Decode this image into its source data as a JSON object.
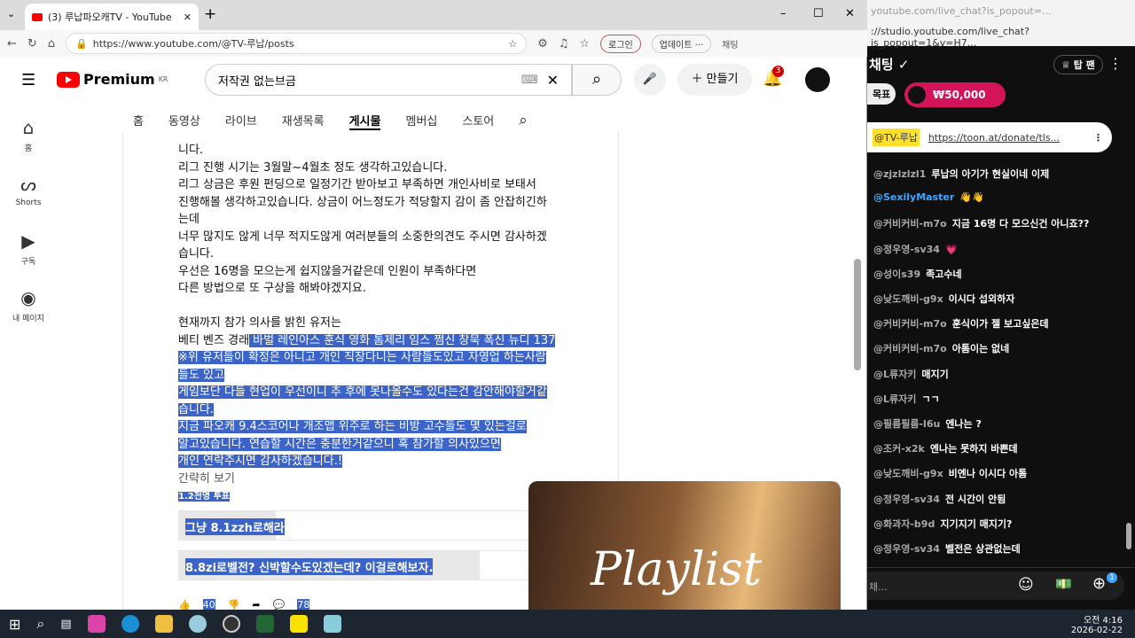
{
  "browser": {
    "tab_title": "(3) 루납파오캐TV - YouTube",
    "url": "https://www.youtube.com/@TV-루납/posts",
    "login": "로그인",
    "update": "업데이트 ···",
    "chat_btn": "채팅"
  },
  "youtube": {
    "logo": "Premium",
    "region": "KR",
    "search_value": "저작권 없는브금",
    "create": "만들기",
    "notif_count": "3",
    "nav": [
      "홈",
      "동영상",
      "라이브",
      "재생목록",
      "게시물",
      "멤버십",
      "스토어"
    ],
    "sidebar": [
      {
        "label": "홈",
        "icon": "home-icon"
      },
      {
        "label": "Shorts",
        "icon": "shorts-icon"
      },
      {
        "label": "구독",
        "icon": "subscriptions-icon"
      },
      {
        "label": "내 페이지",
        "icon": "you-icon"
      }
    ]
  },
  "post": {
    "lines": [
      "니다.",
      "리그 진행 시기는 3월말~4월초 정도 생각하고있습니다.",
      "리그 상금은 후원 펀딩으로 일정기간 받아보고 부족하면 개인사비로 보태서",
      "진행해볼 생각하고있습니다. 상금이 어느정도가 적당할지 감이 좀 안잡히긴하",
      "는데",
      "너무 많지도 않게 너무 적지도않게 여러분들의 소중한의견도 주시면 감사하겠",
      "습니다.",
      "우선은 16명을 모으는게 쉽지않을거같은데 인원이 부족하다면",
      "다른 방법으로 또 구상을 해봐야겠지요.",
      "",
      "현재까지 참가 의사를 밝힌 유저는"
    ],
    "line_users_plain": "베티 벤즈 경래",
    "line_users_sel": " 바벌 레인아스 훈식 영화 톰제리 임스 쩜신 창묵 폭신 뉴디 137",
    "sel_lines": [
      "※위 유저들이 확정은 아니고 개인 직장다니는 사람들도있고 자영업 하는사람",
      "들도 있고",
      "게임보단 다들 현업이 우선이니 추 후에 못나올수도 있다는건 감안해야할거같",
      "습니다.",
      "지금 파오캐 9.4스코어나 개조맵 위주로 하는 비방 고수들도 몇 있는걸로",
      "알고있습니다. 연습할 시간은 충분한거같으니 혹 참가할 의사있으면",
      "개인 연락주시면 감사하겠습니다.!"
    ],
    "show_less": "간략히 보기",
    "votes": "1.2천명 투표",
    "poll": [
      {
        "label": "그냥 8.1zzh로해라",
        "fill": 0.24
      },
      {
        "label": "8.8zi로벨전? 신박할수도있겠는데? 이걸로해보자.",
        "fill": 0.74
      }
    ],
    "likes": "40",
    "comments": "78"
  },
  "playlist": {
    "title": "Playlist"
  },
  "chat": {
    "window_url": "youtube.com/live_chat?is_popout=...",
    "url": "://studio.youtube.com/live_chat?is_popout=1&v=H7...",
    "title": "채팅",
    "top_fan": "탑 팬",
    "goal": "목표",
    "goal_amount": "₩50,000",
    "pinned_user": "@TV-루납",
    "pinned_link": "https://toon.at/donate/tls...",
    "messages": [
      {
        "u": "@zjzlzlzl1",
        "t": "루납의 아기가 현실이네 이제"
      },
      {
        "u": "@SexilyMaster",
        "t": "👋👋"
      },
      {
        "u": "@커비커비-m7o",
        "t": "지금 16명 다 모으신건 아니죠??"
      },
      {
        "u": "@정우영-sv34",
        "t": "💗"
      },
      {
        "u": "@성이s39",
        "t": "족고수네"
      },
      {
        "u": "@낮도깨비-g9x",
        "t": "이시다 섭외하자"
      },
      {
        "u": "@커비커비-m7o",
        "t": "훈식이가 젤 보고싶은데"
      },
      {
        "u": "@커비커비-m7o",
        "t": "아톰이는 없네"
      },
      {
        "u": "@L류자키",
        "t": "매지기"
      },
      {
        "u": "@L류자키",
        "t": "ㄱㄱ"
      },
      {
        "u": "@필름필름-l6u",
        "t": "엔나는 ?"
      },
      {
        "u": "@조커-x2k",
        "t": "엔나는 못하지 바쁜데"
      },
      {
        "u": "@낮도깨비-g9x",
        "t": "비엔나 이시다 아톰"
      },
      {
        "u": "@정우영-sv34",
        "t": "전 시간이 안됨"
      },
      {
        "u": "@화과자-b9d",
        "t": "지기지기 매지기?"
      },
      {
        "u": "@정우영-sv34",
        "t": "벨전은 상관없는데"
      }
    ],
    "input_placeholder": "채...",
    "plus_badge": "1"
  },
  "taskbar": {
    "time": "오전 4:16",
    "date": "2026-02-22"
  }
}
